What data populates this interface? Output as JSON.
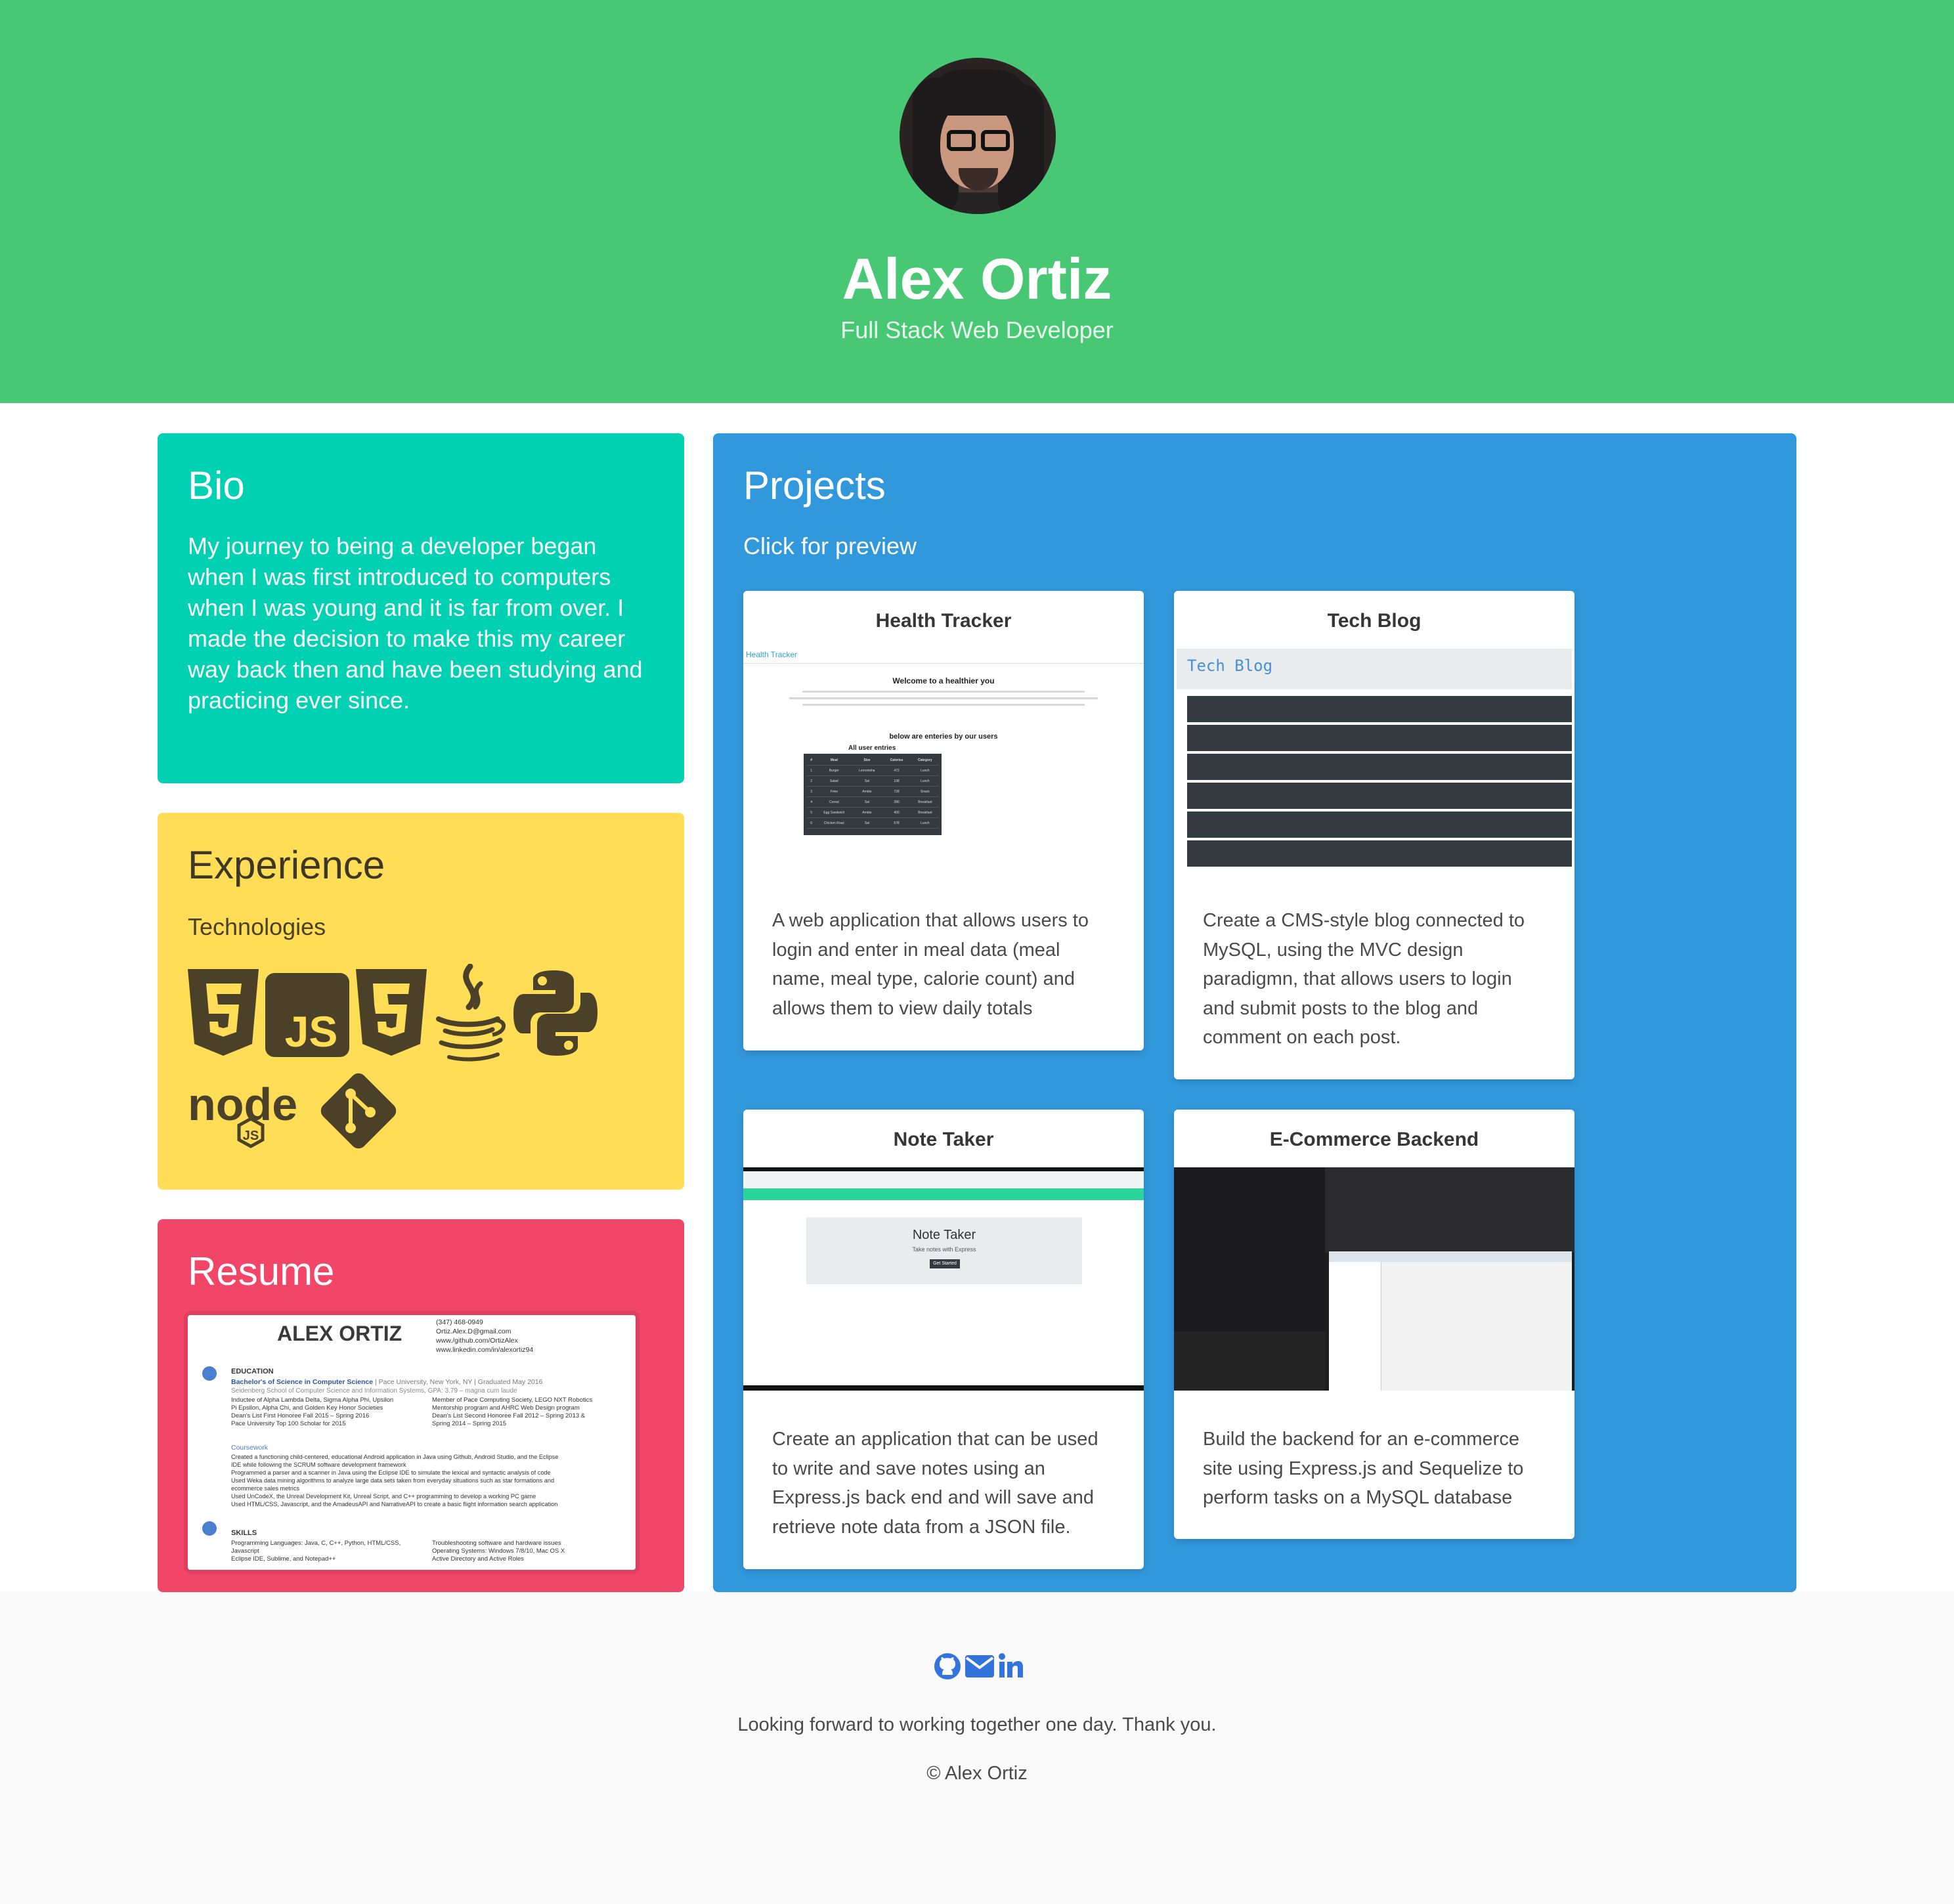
{
  "header": {
    "name": "Alex Ortiz",
    "subtitle": "Full Stack Web Developer",
    "accent": "#48c774"
  },
  "bio": {
    "title": "Bio",
    "text": "My journey to being a developer began when I was first introduced to computers when I was young and it is far from over. I made the decision to make this my career way back then and have been studying and practicing ever since.",
    "color": "#00d1b2"
  },
  "experience": {
    "title": "Experience",
    "subtitle": "Technologies",
    "icons": [
      "html5-icon",
      "javascript-icon",
      "css3-icon",
      "java-icon",
      "python-icon",
      "nodejs-icon",
      "git-icon"
    ],
    "color": "#ffdd57"
  },
  "resume": {
    "title": "Resume",
    "color": "#f14668",
    "doc": {
      "name": "ALEX ORTIZ",
      "contact": [
        "(347) 468-0949",
        "Ortiz.Alex.D@gmail.com",
        "www./github.com/OrtizAlex",
        "www.linkedin.com/in/alexortiz94"
      ],
      "education_heading": "EDUCATION",
      "degree": "Bachelor's of Science in Computer Science",
      "school": " | Pace University, New York, NY | Graduated May 2016",
      "school_line2": "Seidenberg School of Computer Science and Information Systems, GPA: 3.79 – magna cum laude",
      "bullets_left": [
        "Inductee of Alpha Lambda Delta, Sigma Alpha Phi, Upsilon",
        "Pi Epsilon, Alpha Chi, and Golden Key Honor Societies",
        "Dean's List First Honoree Fall 2015 – Spring 2016",
        "Pace University Top 100 Scholar for 2015"
      ],
      "bullets_right": [
        "Member of Pace Computing Society, LEGO NXT Robotics",
        "Mentorship program and AHRC Web Design program",
        "Dean's List Second Honoree Fall 2012 – Spring 2013 &",
        "Spring 2014 – Spring 2015"
      ],
      "coursework_heading": "Coursework",
      "coursework": [
        "Created a functioning child-centered, educational Android application in Java using Github, Android Studio, and the Eclipse",
        "IDE while following the SCRUM software development framework",
        "Programmed a parser and a scanner in Java using the Eclipse IDE to simulate the lexical and syntactic analysis of code",
        "Used Weka data mining algorithms to analyze large data sets taken from everyday situations such as star formations and",
        "ecommerce sales metrics",
        "Used UnCodeX, the Unreal Development Kit, Unreal Script, and C++ programming to develop a working PC game",
        "Used HTML/CSS, Javascript, and the AmadeusAPI and NarrativeAPI to create a basic flight information search application"
      ],
      "skills_heading": "SKILLS",
      "skills_left": [
        "Programming Languages: Java, C, C++, Python, HTML/CSS,",
        "Javascript",
        "Eclipse IDE, Sublime, and Notepad++"
      ],
      "skills_right": [
        "Troubleshooting software and hardware issues",
        "Operating Systems: Windows 7/8/10, Mac OS X",
        "Active Directory and Active Roles"
      ]
    }
  },
  "projects": {
    "title": "Projects",
    "subtitle": "Click for preview",
    "color": "#3298dc",
    "items": [
      {
        "title": "Health Tracker",
        "description": "A web application that allows users to login and enter in meal data (meal name, meal type, calorie count) and allows them to view daily totals",
        "preview": {
          "brand": "Health Tracker",
          "heading": "Welcome to a healthier you",
          "sub_heading": "below are enteries by our users",
          "table_caption": "All user entries",
          "columns": [
            "#",
            "Meal",
            "Size",
            "Calories",
            "Category"
          ],
          "rows": [
            [
              "1",
              "Burger",
              "Lemonisha",
              "472",
              "Lunch"
            ],
            [
              "2",
              "Salad",
              "Sal",
              "198",
              "Lunch"
            ],
            [
              "3",
              "Fries",
              "Amble",
              "728",
              "Snack"
            ],
            [
              "4",
              "Cereal",
              "Sal",
              "280",
              "Breakfast"
            ],
            [
              "5",
              "Egg Sandwich",
              "Amble",
              "400",
              "Breakfast"
            ],
            [
              "6",
              "Chicken Roux",
              "Sal",
              "578",
              "Lunch"
            ]
          ]
        }
      },
      {
        "title": "Tech Blog",
        "description": "Create a CMS-style blog connected to MySQL, using the MVC design paradigmn, that allows users to login and submit posts to the blog and comment on each post.",
        "preview": {
          "brand": "Tech Blog"
        }
      },
      {
        "title": "Note Taker",
        "description": "Create an application that can be used to write and save notes using an Express.js back end and will save and retrieve note data from a JSON file.",
        "preview": {
          "brand": "Note Taker",
          "tagline": "Take notes with Express",
          "button": "Get Started"
        }
      },
      {
        "title": "E-Commerce Backend",
        "description": "Build the backend for an e-commerce site using Express.js and Sequelize to perform tasks on a MySQL database",
        "preview": {}
      }
    ]
  },
  "footer": {
    "icons": [
      "github-icon",
      "email-icon",
      "linkedin-icon"
    ],
    "thanks": "Looking forward to working together one day. Thank you.",
    "copyright": "© Alex Ortiz",
    "icon_color": "#3273dc"
  }
}
